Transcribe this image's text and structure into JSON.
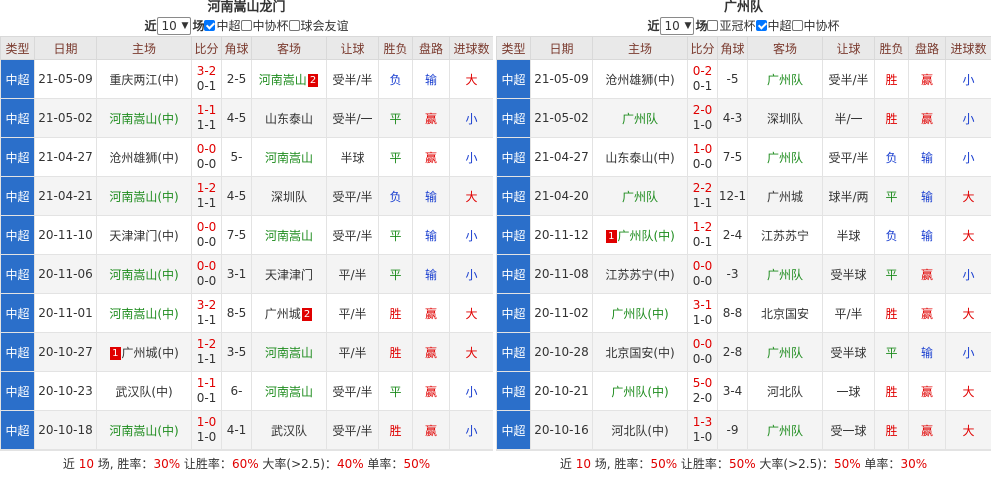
{
  "headers": [
    "类型",
    "日期",
    "主场",
    "比分",
    "角球",
    "客场",
    "让球",
    "胜负",
    "盘路",
    "进球数"
  ],
  "left": {
    "title": "河南嵩山龙门",
    "filter": {
      "prefix": "近",
      "count": "10",
      "suffix": "场",
      "opts": [
        {
          "label": "中超",
          "checked": true
        },
        {
          "label": "中协杯",
          "checked": false
        },
        {
          "label": "球会友谊",
          "checked": false
        }
      ]
    },
    "rows": [
      {
        "league": "中超",
        "date": "21-05-09",
        "home": "重庆两江(中)",
        "home_hl": false,
        "home_badge": "",
        "ft": "3-2",
        "ht": "0-1",
        "corner": "2-5",
        "away": "河南嵩山",
        "away_hl": true,
        "away_badge": "2",
        "hc": "受半/半",
        "wl": "负",
        "wl_c": "blue",
        "pan": "输",
        "pan_c": "blue",
        "ou": "大",
        "ou_c": "red"
      },
      {
        "league": "中超",
        "date": "21-05-02",
        "home": "河南嵩山(中)",
        "home_hl": true,
        "home_badge": "",
        "ft": "1-1",
        "ht": "1-1",
        "corner": "4-5",
        "away": "山东泰山",
        "away_hl": false,
        "away_badge": "",
        "hc": "受半/一",
        "wl": "平",
        "wl_c": "grn",
        "pan": "赢",
        "pan_c": "red",
        "ou": "小",
        "ou_c": "blue"
      },
      {
        "league": "中超",
        "date": "21-04-27",
        "home": "沧州雄狮(中)",
        "home_hl": false,
        "home_badge": "",
        "ft": "0-0",
        "ht": "0-0",
        "corner": "5-",
        "away": "河南嵩山",
        "away_hl": true,
        "away_badge": "",
        "hc": "半球",
        "wl": "平",
        "wl_c": "grn",
        "pan": "赢",
        "pan_c": "red",
        "ou": "小",
        "ou_c": "blue"
      },
      {
        "league": "中超",
        "date": "21-04-21",
        "home": "河南嵩山(中)",
        "home_hl": true,
        "home_badge": "",
        "ft": "1-2",
        "ht": "1-1",
        "corner": "4-5",
        "away": "深圳队",
        "away_hl": false,
        "away_badge": "",
        "hc": "受平/半",
        "wl": "负",
        "wl_c": "blue",
        "pan": "输",
        "pan_c": "blue",
        "ou": "大",
        "ou_c": "red"
      },
      {
        "league": "中超",
        "date": "20-11-10",
        "home": "天津津门(中)",
        "home_hl": false,
        "home_badge": "",
        "ft": "0-0",
        "ht": "0-0",
        "corner": "7-5",
        "away": "河南嵩山",
        "away_hl": true,
        "away_badge": "",
        "hc": "受平/半",
        "wl": "平",
        "wl_c": "grn",
        "pan": "输",
        "pan_c": "blue",
        "ou": "小",
        "ou_c": "blue"
      },
      {
        "league": "中超",
        "date": "20-11-06",
        "home": "河南嵩山(中)",
        "home_hl": true,
        "home_badge": "",
        "ft": "0-0",
        "ht": "0-0",
        "corner": "3-1",
        "away": "天津津门",
        "away_hl": false,
        "away_badge": "",
        "hc": "平/半",
        "wl": "平",
        "wl_c": "grn",
        "pan": "输",
        "pan_c": "blue",
        "ou": "小",
        "ou_c": "blue"
      },
      {
        "league": "中超",
        "date": "20-11-01",
        "home": "河南嵩山(中)",
        "home_hl": true,
        "home_badge": "",
        "ft": "3-2",
        "ht": "1-1",
        "corner": "8-5",
        "away": "广州城",
        "away_hl": false,
        "away_badge": "2",
        "hc": "平/半",
        "wl": "胜",
        "wl_c": "red",
        "pan": "赢",
        "pan_c": "red",
        "ou": "大",
        "ou_c": "red"
      },
      {
        "league": "中超",
        "date": "20-10-27",
        "home": "广州城(中)",
        "home_hl": false,
        "home_badge": "1",
        "ft": "1-2",
        "ht": "1-1",
        "corner": "3-5",
        "away": "河南嵩山",
        "away_hl": true,
        "away_badge": "",
        "hc": "平/半",
        "wl": "胜",
        "wl_c": "red",
        "pan": "赢",
        "pan_c": "red",
        "ou": "大",
        "ou_c": "red"
      },
      {
        "league": "中超",
        "date": "20-10-23",
        "home": "武汉队(中)",
        "home_hl": false,
        "home_badge": "",
        "ft": "1-1",
        "ht": "0-1",
        "corner": "6-",
        "away": "河南嵩山",
        "away_hl": true,
        "away_badge": "",
        "hc": "受平/半",
        "wl": "平",
        "wl_c": "grn",
        "pan": "赢",
        "pan_c": "red",
        "ou": "小",
        "ou_c": "blue"
      },
      {
        "league": "中超",
        "date": "20-10-18",
        "home": "河南嵩山(中)",
        "home_hl": true,
        "home_badge": "",
        "ft": "1-0",
        "ht": "1-0",
        "corner": "4-1",
        "away": "武汉队",
        "away_hl": false,
        "away_badge": "",
        "hc": "受平/半",
        "wl": "胜",
        "wl_c": "red",
        "pan": "赢",
        "pan_c": "red",
        "ou": "小",
        "ou_c": "blue"
      }
    ],
    "summary": {
      "p1": "近 ",
      "count": "10",
      "p2": " 场, 胜率：",
      "win": "30%",
      "p3": " 让胜率：",
      "hwin": "60%",
      "p4": " 大率(>2.5)：",
      "big": "40%",
      "p5": " 单率：",
      "odd": "50%"
    }
  },
  "right": {
    "title": "广州队",
    "filter": {
      "prefix": "近",
      "count": "10",
      "suffix": "场",
      "opts": [
        {
          "label": "亚冠杯",
          "checked": false
        },
        {
          "label": "中超",
          "checked": true
        },
        {
          "label": "中协杯",
          "checked": false
        }
      ]
    },
    "rows": [
      {
        "league": "中超",
        "date": "21-05-09",
        "home": "沧州雄狮(中)",
        "home_hl": false,
        "home_badge": "",
        "ft": "0-2",
        "ht": "0-1",
        "corner": "-5",
        "away": "广州队",
        "away_hl": true,
        "away_badge": "",
        "hc": "受半/半",
        "wl": "胜",
        "wl_c": "red",
        "pan": "赢",
        "pan_c": "red",
        "ou": "小",
        "ou_c": "blue"
      },
      {
        "league": "中超",
        "date": "21-05-02",
        "home": "广州队",
        "home_hl": true,
        "home_badge": "",
        "ft": "2-0",
        "ht": "1-0",
        "corner": "4-3",
        "away": "深圳队",
        "away_hl": false,
        "away_badge": "",
        "hc": "半/一",
        "wl": "胜",
        "wl_c": "red",
        "pan": "赢",
        "pan_c": "red",
        "ou": "小",
        "ou_c": "blue"
      },
      {
        "league": "中超",
        "date": "21-04-27",
        "home": "山东泰山(中)",
        "home_hl": false,
        "home_badge": "",
        "ft": "1-0",
        "ht": "0-0",
        "corner": "7-5",
        "away": "广州队",
        "away_hl": true,
        "away_badge": "",
        "hc": "受平/半",
        "wl": "负",
        "wl_c": "blue",
        "pan": "输",
        "pan_c": "blue",
        "ou": "小",
        "ou_c": "blue"
      },
      {
        "league": "中超",
        "date": "21-04-20",
        "home": "广州队",
        "home_hl": true,
        "home_badge": "",
        "ft": "2-2",
        "ht": "1-1",
        "corner": "12-1",
        "away": "广州城",
        "away_hl": false,
        "away_badge": "",
        "hc": "球半/两",
        "wl": "平",
        "wl_c": "grn",
        "pan": "输",
        "pan_c": "blue",
        "ou": "大",
        "ou_c": "red"
      },
      {
        "league": "中超",
        "date": "20-11-12",
        "home": "广州队(中)",
        "home_hl": true,
        "home_badge": "1",
        "ft": "1-2",
        "ht": "0-1",
        "corner": "2-4",
        "away": "江苏苏宁",
        "away_hl": false,
        "away_badge": "",
        "hc": "半球",
        "wl": "负",
        "wl_c": "blue",
        "pan": "输",
        "pan_c": "blue",
        "ou": "大",
        "ou_c": "red"
      },
      {
        "league": "中超",
        "date": "20-11-08",
        "home": "江苏苏宁(中)",
        "home_hl": false,
        "home_badge": "",
        "ft": "0-0",
        "ht": "0-0",
        "corner": "-3",
        "away": "广州队",
        "away_hl": true,
        "away_badge": "",
        "hc": "受半球",
        "wl": "平",
        "wl_c": "grn",
        "pan": "赢",
        "pan_c": "red",
        "ou": "小",
        "ou_c": "blue"
      },
      {
        "league": "中超",
        "date": "20-11-02",
        "home": "广州队(中)",
        "home_hl": true,
        "home_badge": "",
        "ft": "3-1",
        "ht": "1-0",
        "corner": "8-8",
        "away": "北京国安",
        "away_hl": false,
        "away_badge": "",
        "hc": "平/半",
        "wl": "胜",
        "wl_c": "red",
        "pan": "赢",
        "pan_c": "red",
        "ou": "大",
        "ou_c": "red"
      },
      {
        "league": "中超",
        "date": "20-10-28",
        "home": "北京国安(中)",
        "home_hl": false,
        "home_badge": "",
        "ft": "0-0",
        "ht": "0-0",
        "corner": "2-8",
        "away": "广州队",
        "away_hl": true,
        "away_badge": "",
        "hc": "受半球",
        "wl": "平",
        "wl_c": "grn",
        "pan": "输",
        "pan_c": "blue",
        "ou": "小",
        "ou_c": "blue"
      },
      {
        "league": "中超",
        "date": "20-10-21",
        "home": "广州队(中)",
        "home_hl": true,
        "home_badge": "",
        "ft": "5-0",
        "ht": "2-0",
        "corner": "3-4",
        "away": "河北队",
        "away_hl": false,
        "away_badge": "",
        "hc": "一球",
        "wl": "胜",
        "wl_c": "red",
        "pan": "赢",
        "pan_c": "red",
        "ou": "大",
        "ou_c": "red"
      },
      {
        "league": "中超",
        "date": "20-10-16",
        "home": "河北队(中)",
        "home_hl": false,
        "home_badge": "",
        "ft": "1-3",
        "ht": "1-0",
        "corner": "-9",
        "away": "广州队",
        "away_hl": true,
        "away_badge": "",
        "hc": "受一球",
        "wl": "胜",
        "wl_c": "red",
        "pan": "赢",
        "pan_c": "red",
        "ou": "大",
        "ou_c": "red"
      }
    ],
    "summary": {
      "p1": "近 ",
      "count": "10",
      "p2": " 场, 胜率：",
      "win": "50%",
      "p3": " 让胜率：",
      "hwin": "50%",
      "p4": " 大率(>2.5)：",
      "big": "50%",
      "p5": " 单率：",
      "odd": "30%"
    }
  }
}
